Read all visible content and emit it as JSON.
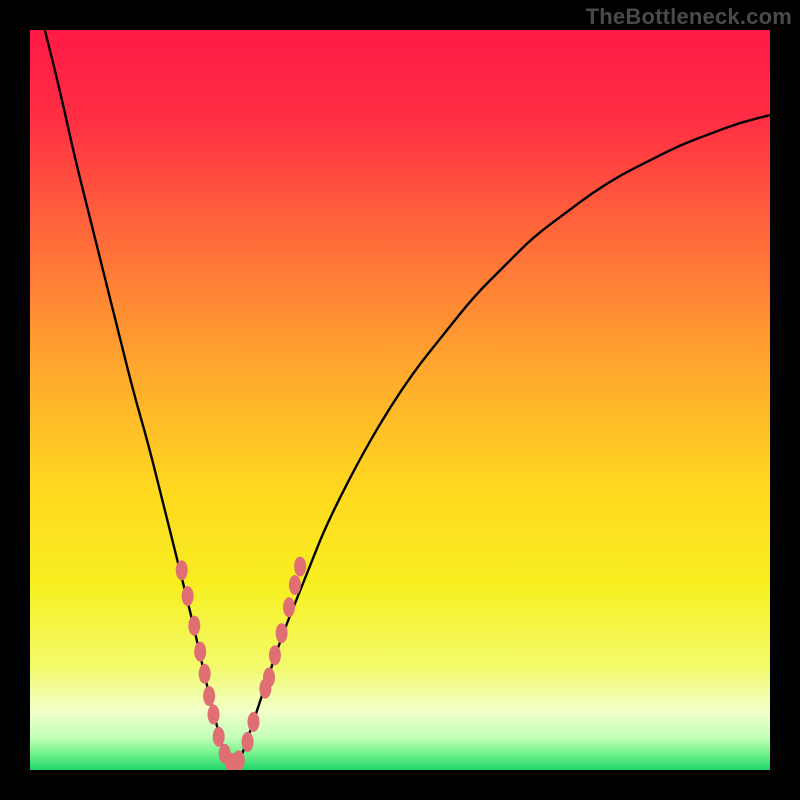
{
  "watermark": "TheBottleneck.com",
  "colors": {
    "frame": "#000000",
    "gradient_stops": [
      {
        "offset": 0.0,
        "color": "#ff1a45"
      },
      {
        "offset": 0.12,
        "color": "#ff2e44"
      },
      {
        "offset": 0.28,
        "color": "#ff6a3a"
      },
      {
        "offset": 0.45,
        "color": "#ffa52e"
      },
      {
        "offset": 0.62,
        "color": "#ffd81f"
      },
      {
        "offset": 0.75,
        "color": "#f7ef20"
      },
      {
        "offset": 0.86,
        "color": "#f3fb6b"
      },
      {
        "offset": 0.92,
        "color": "#f2ffc8"
      },
      {
        "offset": 0.955,
        "color": "#c6ffba"
      },
      {
        "offset": 0.975,
        "color": "#7cf58f"
      },
      {
        "offset": 1.0,
        "color": "#21d66a"
      }
    ],
    "curve": "#000000",
    "marker_fill": "#e06f74",
    "marker_stroke": "#e06f74"
  },
  "chart_data": {
    "type": "line",
    "title": "",
    "xlabel": "",
    "ylabel": "",
    "xlim": [
      0,
      100
    ],
    "ylim": [
      0,
      100
    ],
    "comment": "Two black curves descending into a narrow V near x≈27; values are the curve height as percent of plot height (0 at bottom, 100 at top), read off the image.",
    "series": [
      {
        "name": "left-curve",
        "x": [
          2,
          4,
          6,
          8,
          10,
          12,
          14,
          16,
          18,
          20,
          22,
          24,
          25,
          26,
          27
        ],
        "values": [
          100,
          92,
          83,
          75,
          67,
          59,
          51,
          44,
          36,
          28,
          20,
          11,
          7,
          3,
          0.5
        ]
      },
      {
        "name": "right-curve",
        "x": [
          28,
          29,
          30,
          32,
          34,
          36,
          38,
          40,
          44,
          48,
          52,
          56,
          60,
          64,
          68,
          72,
          76,
          80,
          84,
          88,
          92,
          96,
          100
        ],
        "values": [
          0.5,
          3,
          6,
          12,
          18,
          23,
          28,
          33,
          41,
          48,
          54,
          59,
          64,
          68,
          72,
          75,
          78,
          80.5,
          82.5,
          84.5,
          86,
          87.5,
          88.5
        ]
      }
    ],
    "markers": {
      "comment": "Salmon oblong markers near the valley on both curves; (x, y) in same percent coords.",
      "points": [
        [
          20.5,
          27
        ],
        [
          21.3,
          23.5
        ],
        [
          22.2,
          19.5
        ],
        [
          23.0,
          16
        ],
        [
          23.6,
          13
        ],
        [
          24.2,
          10
        ],
        [
          24.8,
          7.5
        ],
        [
          25.5,
          4.5
        ],
        [
          26.3,
          2.2
        ],
        [
          27.2,
          1.0
        ],
        [
          28.2,
          1.3
        ],
        [
          29.4,
          3.8
        ],
        [
          30.2,
          6.5
        ],
        [
          31.8,
          11
        ],
        [
          32.3,
          12.5
        ],
        [
          33.1,
          15.5
        ],
        [
          34.0,
          18.5
        ],
        [
          35.0,
          22
        ],
        [
          35.8,
          25
        ],
        [
          36.5,
          27.5
        ]
      ],
      "radius_px": 8
    }
  }
}
